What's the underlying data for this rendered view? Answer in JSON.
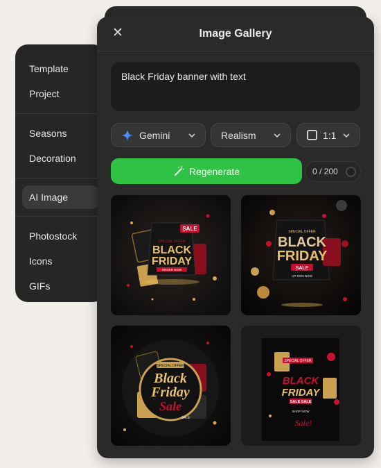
{
  "sidebar": {
    "groups": [
      [
        "Template",
        "Project"
      ],
      [
        "Seasons",
        "Decoration"
      ],
      [
        "AI Image"
      ],
      [
        "Photostock",
        "Icons",
        "GIFs"
      ]
    ],
    "active": "AI Image"
  },
  "panel": {
    "title": "Image Gallery",
    "close_icon": "close-icon",
    "prompt_value": "Black Friday banner with text",
    "model": "Gemini",
    "style": "Realism",
    "ratio": "1:1",
    "regenerate_label": "Regenerate",
    "counter": "0 / 200"
  },
  "gallery": [
    {
      "line1": "BLACK",
      "line2": "FRIDAY",
      "badge": "SALE",
      "top_label": "SPECIAL OFFER",
      "bottom_label": "ORDER NOW"
    },
    {
      "line1": "BLACK",
      "line2": "FRIDAY",
      "badge": "SALE",
      "top_label": "SPECIAL OFFER",
      "bottom_label": "UP DON NOW"
    },
    {
      "line1": "Black",
      "line2": "Friday",
      "badge": "Sale",
      "top_label": "SPECIAL OFFER",
      "bottom_label": "SALE"
    },
    {
      "line1": "BLACK",
      "line2": "FRIDAY",
      "badge": "SALE SALE",
      "top_label": "SPECIAL OFFER",
      "bottom_label": "SHOP NOW",
      "script": "Sale!"
    }
  ],
  "colors": {
    "accent_green": "#2fc244",
    "panel_bg": "#2a2a2a",
    "gold": "#d4a74e",
    "red": "#c8102e"
  }
}
